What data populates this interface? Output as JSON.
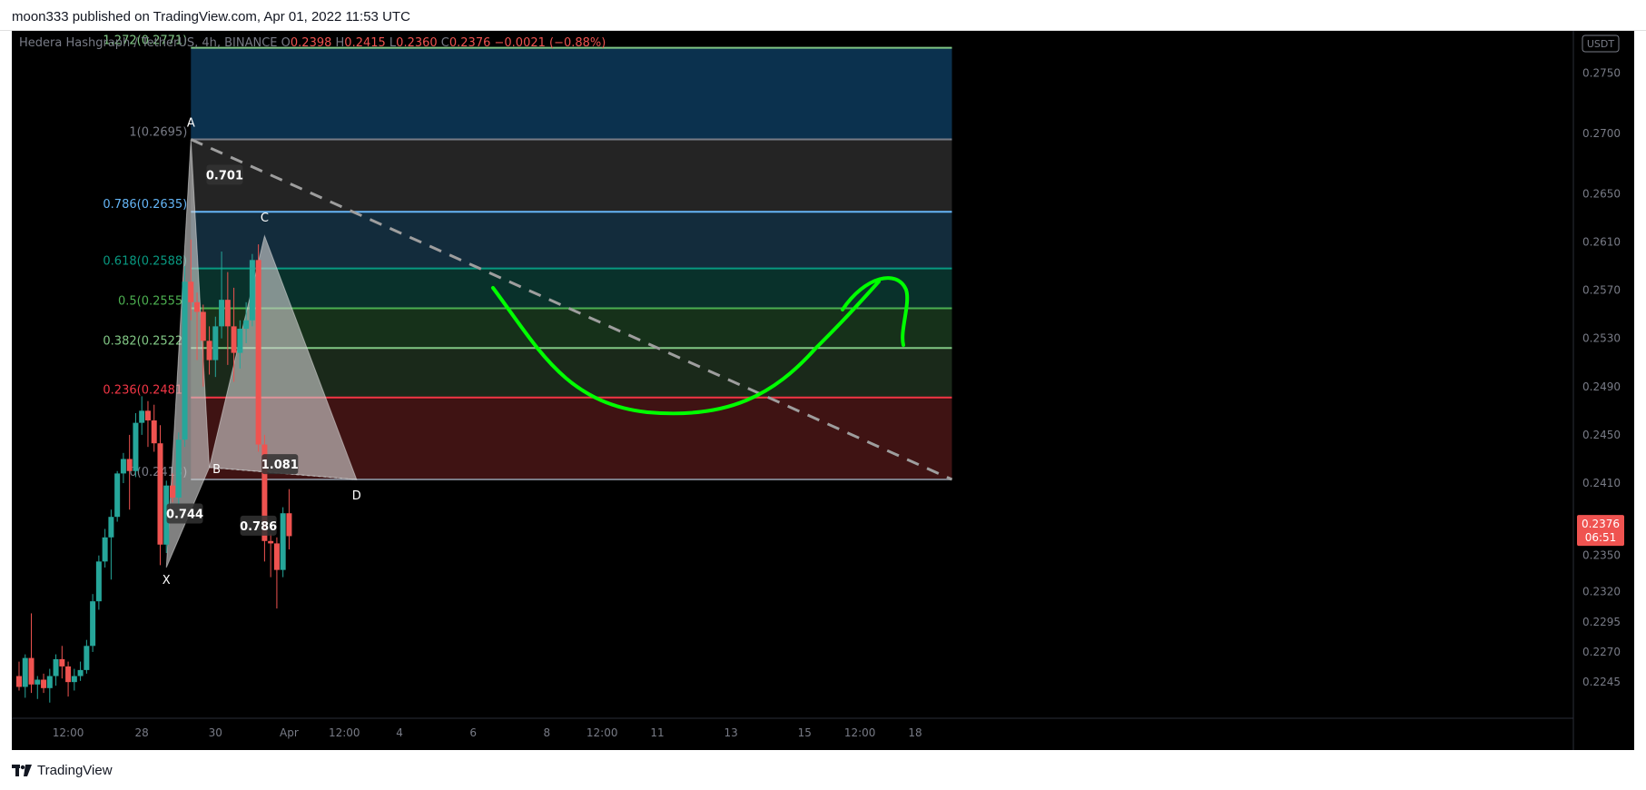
{
  "header": {
    "published_text": "moon333 published on TradingView.com, Apr 01, 2022 11:53 UTC"
  },
  "footer": {
    "logo_text": "TradingView",
    "logo_icon": "tradingview-logo-icon"
  },
  "colors": {
    "background": "#000000",
    "up_candle": "#26a69a",
    "down_candle": "#ef5350",
    "fib_1272": "#81c784",
    "fib_1": "#787b86",
    "fib_0786": "#64b5f6",
    "fib_0618": "#089981",
    "fib_05": "#4caf50",
    "fib_0382": "#81c784",
    "fib_0236": "#f23645",
    "fib_0": "#787b86",
    "harmonic_fill": "#cfcfcf",
    "drawing_green": "#00ff00",
    "price_badge": "#ef5350"
  },
  "chart_data": {
    "type": "candlestick",
    "symbol_line": {
      "name": "Hedera Hashgraph / TetherUS, 4h, BINANCE",
      "open_label": "O",
      "open": "0.2398",
      "high_label": "H",
      "high": "0.2415",
      "low_label": "L",
      "low": "0.2360",
      "close_label": "C",
      "close": "0.2376",
      "change": "−0.0021 (−0.88%)"
    },
    "currency_badge": "USDT",
    "ylim": [
      0.2215,
      0.2785
    ],
    "y_ticks": [
      "0.2750",
      "0.2700",
      "0.2650",
      "0.2610",
      "0.2570",
      "0.2530",
      "0.2490",
      "0.2450",
      "0.2410",
      "0.2350",
      "0.2320",
      "0.2295",
      "0.2270",
      "0.2245"
    ],
    "x_ticks": [
      {
        "label": "12:00",
        "index": 8
      },
      {
        "label": "28",
        "index": 20
      },
      {
        "label": "30",
        "index": 32
      },
      {
        "label": "Apr",
        "index": 44
      },
      {
        "label": "12:00",
        "index": 53
      },
      {
        "label": "4",
        "index": 62
      },
      {
        "label": "6",
        "index": 74
      },
      {
        "label": "8",
        "index": 86
      },
      {
        "label": "12:00",
        "index": 95
      },
      {
        "label": "11",
        "index": 104
      },
      {
        "label": "13",
        "index": 116
      },
      {
        "label": "15",
        "index": 128
      },
      {
        "label": "12:00",
        "index": 137
      },
      {
        "label": "18",
        "index": 146
      }
    ],
    "last_price": {
      "value": "0.2376",
      "countdown": "06:51"
    },
    "candles": [
      [
        0.225,
        0.2262,
        0.2238,
        0.2241
      ],
      [
        0.2241,
        0.2268,
        0.2232,
        0.2265
      ],
      [
        0.2265,
        0.2302,
        0.2236,
        0.2243
      ],
      [
        0.2243,
        0.225,
        0.2231,
        0.2247
      ],
      [
        0.2247,
        0.2252,
        0.2236,
        0.224
      ],
      [
        0.224,
        0.2256,
        0.2228,
        0.225
      ],
      [
        0.225,
        0.2268,
        0.2242,
        0.2264
      ],
      [
        0.2264,
        0.2275,
        0.2248,
        0.2258
      ],
      [
        0.2258,
        0.2262,
        0.2233,
        0.2245
      ],
      [
        0.2245,
        0.2256,
        0.2238,
        0.225
      ],
      [
        0.225,
        0.2262,
        0.2246,
        0.2255
      ],
      [
        0.2255,
        0.228,
        0.2252,
        0.2275
      ],
      [
        0.2275,
        0.2318,
        0.227,
        0.2312
      ],
      [
        0.2312,
        0.235,
        0.2305,
        0.2345
      ],
      [
        0.2345,
        0.2372,
        0.234,
        0.2365
      ],
      [
        0.2365,
        0.2388,
        0.233,
        0.2382
      ],
      [
        0.2382,
        0.242,
        0.2378,
        0.2418
      ],
      [
        0.2418,
        0.2435,
        0.241,
        0.243
      ],
      [
        0.243,
        0.245,
        0.2388,
        0.242
      ],
      [
        0.242,
        0.2468,
        0.2415,
        0.246
      ],
      [
        0.246,
        0.2482,
        0.245,
        0.247
      ],
      [
        0.247,
        0.2478,
        0.244,
        0.2462
      ],
      [
        0.2462,
        0.2475,
        0.2436,
        0.2443
      ],
      [
        0.2443,
        0.2458,
        0.2342,
        0.2359
      ],
      [
        0.2359,
        0.2412,
        0.2352,
        0.2408
      ],
      [
        0.2408,
        0.2418,
        0.2394,
        0.2398
      ],
      [
        0.2398,
        0.2452,
        0.2392,
        0.2446
      ],
      [
        0.2446,
        0.259,
        0.244,
        0.2577
      ],
      [
        0.2577,
        0.2612,
        0.2545,
        0.256
      ],
      [
        0.256,
        0.2568,
        0.2512,
        0.2552
      ],
      [
        0.2552,
        0.2558,
        0.249,
        0.2528
      ],
      [
        0.2528,
        0.254,
        0.25,
        0.2512
      ],
      [
        0.2512,
        0.2548,
        0.2498,
        0.254
      ],
      [
        0.254,
        0.2602,
        0.253,
        0.2562
      ],
      [
        0.2562,
        0.2585,
        0.2508,
        0.254
      ],
      [
        0.254,
        0.2572,
        0.2494,
        0.2518
      ],
      [
        0.2518,
        0.2545,
        0.2505,
        0.2538
      ],
      [
        0.2538,
        0.256,
        0.2526,
        0.2545
      ],
      [
        0.2545,
        0.26,
        0.254,
        0.2595
      ],
      [
        0.2595,
        0.2608,
        0.2436,
        0.2442
      ],
      [
        0.2442,
        0.245,
        0.2345,
        0.2362
      ],
      [
        0.2362,
        0.2368,
        0.2332,
        0.236
      ],
      [
        0.236,
        0.2365,
        0.2306,
        0.2338
      ],
      [
        0.2338,
        0.239,
        0.2332,
        0.2385
      ],
      [
        0.2385,
        0.2405,
        0.2355,
        0.2366
      ]
    ],
    "fib_levels": [
      {
        "ratio": 1.272,
        "label": "1.272(0.2771)",
        "price": 0.2771,
        "color": "#81c784"
      },
      {
        "ratio": 1,
        "label": "1(0.2695)",
        "price": 0.2695,
        "color": "#787b86"
      },
      {
        "ratio": 0.786,
        "label": "0.786(0.2635)",
        "price": 0.2635,
        "color": "#64b5f6"
      },
      {
        "ratio": 0.618,
        "label": "0.618(0.2588)",
        "price": 0.2588,
        "color": "#089981"
      },
      {
        "ratio": 0.5,
        "label": "0.5(0.2555)",
        "price": 0.2555,
        "color": "#4caf50"
      },
      {
        "ratio": 0.382,
        "label": "0.382(0.2522)",
        "price": 0.2522,
        "color": "#81c784"
      },
      {
        "ratio": 0.236,
        "label": "0.236(0.2481)",
        "price": 0.2481,
        "color": "#f23645"
      },
      {
        "ratio": 0,
        "label": "0(0.2413)",
        "price": 0.2413,
        "color": "#787b86"
      }
    ],
    "fib_zones": [
      {
        "top": 0.2771,
        "bottom": 0.2695,
        "color": "#0d3a5c"
      },
      {
        "top": 0.2695,
        "bottom": 0.2635,
        "color": "#2a2a2a"
      },
      {
        "top": 0.2635,
        "bottom": 0.2588,
        "color": "#163447"
      },
      {
        "top": 0.2588,
        "bottom": 0.2555,
        "color": "#0b3a33"
      },
      {
        "top": 0.2555,
        "bottom": 0.2522,
        "color": "#1a3a1e"
      },
      {
        "top": 0.2522,
        "bottom": 0.2481,
        "color": "#1f301f"
      },
      {
        "top": 0.2481,
        "bottom": 0.2413,
        "color": "#4a1616"
      }
    ],
    "harmonic": {
      "points": [
        {
          "name": "X",
          "index": 24,
          "price": 0.234
        },
        {
          "name": "A",
          "index": 28,
          "price": 0.2695
        },
        {
          "name": "B",
          "index": 31,
          "price": 0.2423
        },
        {
          "name": "C",
          "index": 40,
          "price": 0.2615
        },
        {
          "name": "D",
          "index": 55,
          "price": 0.2413
        }
      ],
      "ratios": [
        {
          "text": "0.701",
          "index": 33.5,
          "price": 0.2665
        },
        {
          "text": "0.744",
          "index": 27,
          "price": 0.2384
        },
        {
          "text": "1.081",
          "index": 42.5,
          "price": 0.2425
        },
        {
          "text": "0.786",
          "index": 39,
          "price": 0.2374
        }
      ]
    },
    "trendline": {
      "from": {
        "index": 28,
        "price": 0.2695
      },
      "to": {
        "index": 152,
        "price": 0.2413
      }
    },
    "fib_range": {
      "from_index": 28,
      "to_index": 152
    }
  }
}
